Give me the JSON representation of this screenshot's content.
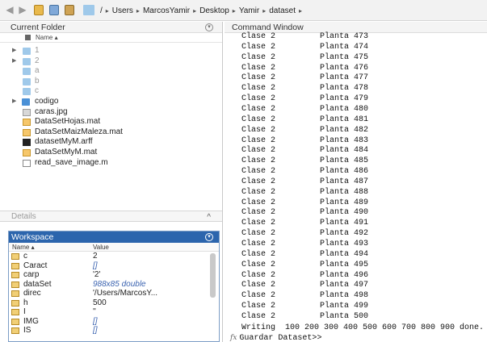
{
  "toolbar": {
    "back_icon": "back-arrow",
    "forward_icon": "forward-arrow",
    "icons": [
      "folder-up",
      "browse-folder",
      "new-folder"
    ],
    "path": [
      "/",
      "Users",
      "MarcosYamir",
      "Desktop",
      "Yamir",
      "dataset"
    ]
  },
  "current_folder": {
    "title": "Current Folder",
    "column_header": "Name ▴",
    "items": [
      {
        "name": "1",
        "type": "folder",
        "expandable": true,
        "dim": true
      },
      {
        "name": "2",
        "type": "folder",
        "expandable": true,
        "dim": true
      },
      {
        "name": "a",
        "type": "folder",
        "expandable": false,
        "dim": true
      },
      {
        "name": "b",
        "type": "folder",
        "expandable": false,
        "dim": true
      },
      {
        "name": "c",
        "type": "folder",
        "expandable": false,
        "dim": true
      },
      {
        "name": "codigo",
        "type": "folder-dark",
        "expandable": true,
        "dim": false
      },
      {
        "name": "caras.jpg",
        "type": "jpg",
        "expandable": false,
        "dim": false
      },
      {
        "name": "DataSetHojas.mat",
        "type": "mat",
        "expandable": false,
        "dim": false
      },
      {
        "name": "DataSetMaizMaleza.mat",
        "type": "mat",
        "expandable": false,
        "dim": false
      },
      {
        "name": "datasetMyM.arff",
        "type": "arff",
        "expandable": false,
        "dim": false
      },
      {
        "name": "DataSetMyM.mat",
        "type": "mat",
        "expandable": false,
        "dim": false
      },
      {
        "name": "read_save_image.m",
        "type": "m",
        "expandable": false,
        "dim": false
      }
    ]
  },
  "details": {
    "title": "Details",
    "caret": "^"
  },
  "workspace": {
    "title": "Workspace",
    "col_name": "Name ▴",
    "col_value": "Value",
    "rows": [
      {
        "name": "c",
        "value": "2",
        "italic": false
      },
      {
        "name": "Caract",
        "value": "[]",
        "italic": true
      },
      {
        "name": "carp",
        "value": "'2'",
        "italic": false
      },
      {
        "name": "dataSet",
        "value": "988x85 double",
        "italic": true
      },
      {
        "name": "direc",
        "value": "'/Users/MarcosY...",
        "italic": false
      },
      {
        "name": "h",
        "value": "500",
        "italic": false
      },
      {
        "name": "I",
        "value": "''",
        "italic": false
      },
      {
        "name": "IMG",
        "value": "[]",
        "italic": true
      },
      {
        "name": "IS",
        "value": "[]",
        "italic": true
      }
    ]
  },
  "command_window": {
    "title": "Command Window",
    "lines": [
      [
        "Clase 2",
        "Planta 473"
      ],
      [
        "Clase 2",
        "Planta 474"
      ],
      [
        "Clase 2",
        "Planta 475"
      ],
      [
        "Clase 2",
        "Planta 476"
      ],
      [
        "Clase 2",
        "Planta 477"
      ],
      [
        "Clase 2",
        "Planta 478"
      ],
      [
        "Clase 2",
        "Planta 479"
      ],
      [
        "Clase 2",
        "Planta 480"
      ],
      [
        "Clase 2",
        "Planta 481"
      ],
      [
        "Clase 2",
        "Planta 482"
      ],
      [
        "Clase 2",
        "Planta 483"
      ],
      [
        "Clase 2",
        "Planta 484"
      ],
      [
        "Clase 2",
        "Planta 485"
      ],
      [
        "Clase 2",
        "Planta 486"
      ],
      [
        "Clase 2",
        "Planta 487"
      ],
      [
        "Clase 2",
        "Planta 488"
      ],
      [
        "Clase 2",
        "Planta 489"
      ],
      [
        "Clase 2",
        "Planta 490"
      ],
      [
        "Clase 2",
        "Planta 491"
      ],
      [
        "Clase 2",
        "Planta 492"
      ],
      [
        "Clase 2",
        "Planta 493"
      ],
      [
        "Clase 2",
        "Planta 494"
      ],
      [
        "Clase 2",
        "Planta 495"
      ],
      [
        "Clase 2",
        "Planta 496"
      ],
      [
        "Clase 2",
        "Planta 497"
      ],
      [
        "Clase 2",
        "Planta 498"
      ],
      [
        "Clase 2",
        "Planta 499"
      ],
      [
        "Clase 2",
        "Planta 500"
      ]
    ],
    "writing": "Writing  100 200 300 400 500 600 700 800 900 done.",
    "prompt_icon": "fx",
    "prompt": "Guardar Dataset>>"
  }
}
